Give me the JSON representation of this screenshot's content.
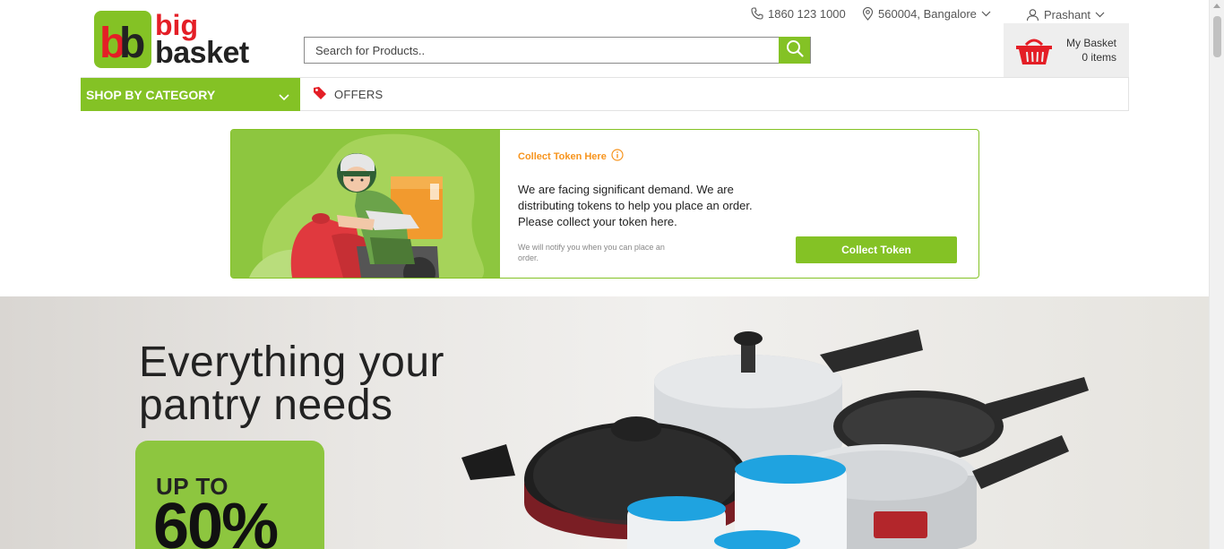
{
  "brand": {
    "logo_big": "big",
    "logo_basket": "basket",
    "logo_mark": "bb"
  },
  "topbar": {
    "phone": "1860 123 1000",
    "location": "560004, Bangalore",
    "user": "Prashant"
  },
  "search": {
    "placeholder": "Search for Products.."
  },
  "basket": {
    "title": "My Basket",
    "count": "0 items"
  },
  "nav": {
    "shop_by_category": "SHOP BY CATEGORY",
    "offers": "OFFERS"
  },
  "token": {
    "label": "Collect Token Here",
    "message": "We are facing significant demand. We are distributing tokens to help you place an order. Please collect your token here.",
    "note": "We will notify you when you can place an order.",
    "button": "Collect Token"
  },
  "banner": {
    "title_line1": "Everything your",
    "title_line2": "pantry needs",
    "badge_upto": "UP TO",
    "badge_pct": "60%"
  },
  "colors": {
    "brand_green": "#84c225",
    "brand_red": "#e41e26",
    "token_orange": "#f7941d"
  }
}
